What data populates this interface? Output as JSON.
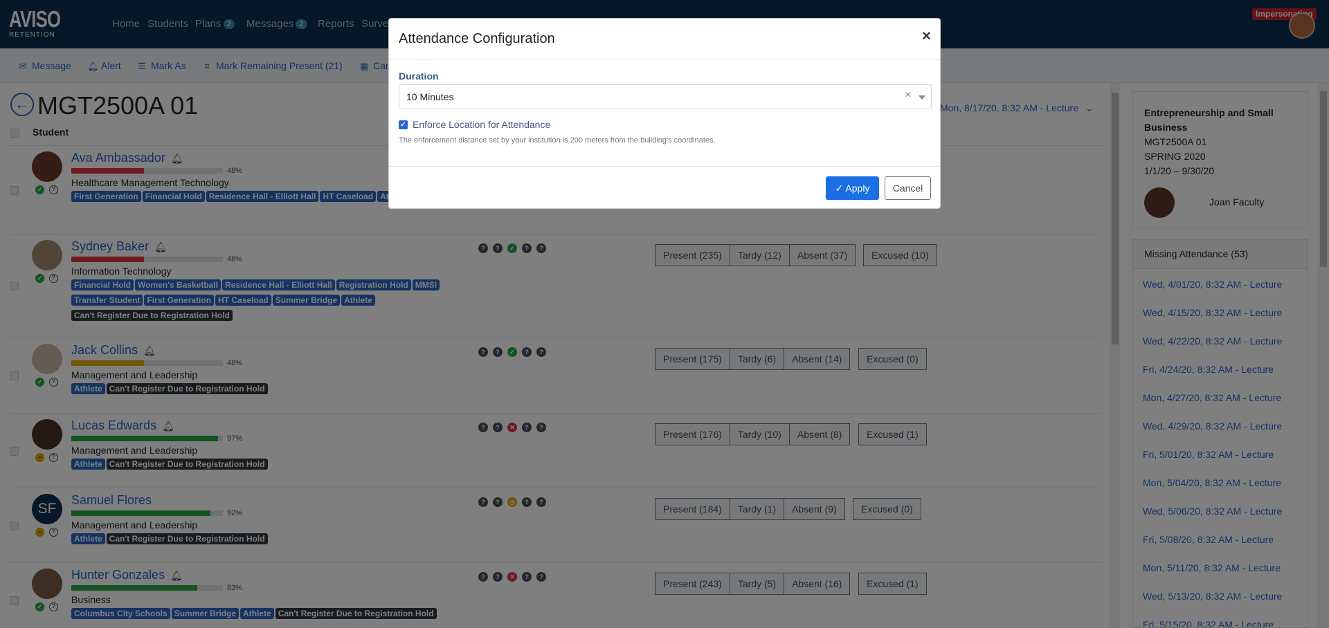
{
  "nav": {
    "logo_top": "AVISO",
    "logo_bottom": "RETENTION",
    "items": [
      {
        "label": "Home"
      },
      {
        "label": "Students"
      },
      {
        "label": "Plans",
        "badge": "2"
      },
      {
        "label": "Messages",
        "badge": "2"
      },
      {
        "label": "Reports"
      },
      {
        "label": "Surveys"
      }
    ],
    "impersonating": "Impersonating"
  },
  "toolbar": {
    "message": "Message",
    "alert": "Alert",
    "mark_as": "Mark As",
    "mark_remaining": "Mark Remaining Present (21)",
    "cancel_cut": "Can"
  },
  "course": {
    "code": "MGT2500A 01",
    "session": "Mon, 8/17/20, 8:32 AM - Lecture",
    "student_header": "Student"
  },
  "students": [
    {
      "name": "Ava Ambassador",
      "pct": "48%",
      "pct_value": 0.48,
      "bar_color": "#dc3545",
      "major": "Healthcare Management Technology",
      "tags": [
        {
          "t": "First Generation"
        },
        {
          "t": "Financial Hold"
        },
        {
          "t": "Residence Hall - Elliott Hall"
        },
        {
          "t": "HT Caseload"
        },
        {
          "t": "Athlete"
        }
      ],
      "present": "",
      "tardy": "",
      "absent": "",
      "excused": ""
    },
    {
      "name": "Sydney Baker",
      "pct": "48%",
      "pct_value": 0.48,
      "bar_color": "#dc3545",
      "major": "Information Technology",
      "tags": [
        {
          "t": "Financial Hold"
        },
        {
          "t": "Women's Basketball"
        },
        {
          "t": "Residence Hall - Elliott Hall"
        },
        {
          "t": "Registration Hold"
        },
        {
          "t": "MMSI"
        },
        {
          "t": "Transfer Student"
        },
        {
          "t": "First Generation"
        },
        {
          "t": "HT Caseload"
        },
        {
          "t": "Summer Bridge"
        },
        {
          "t": "Athlete"
        },
        {
          "t": "Can't Register Due to Registration Hold",
          "dark": true
        }
      ],
      "present": "Present (235)",
      "tardy": "Tardy (12)",
      "absent": "Absent (37)",
      "excused": "Excused (10)"
    },
    {
      "name": "Jack Collins",
      "pct": "48%",
      "pct_value": 0.48,
      "bar_color": "#e0a800",
      "major": "Management and Leadership",
      "tags": [
        {
          "t": "Athlete"
        },
        {
          "t": "Can't Register Due to Registration Hold",
          "dark": true
        }
      ],
      "present": "Present (175)",
      "tardy": "Tardy (6)",
      "absent": "Absent (14)",
      "excused": "Excused (0)"
    },
    {
      "name": "Lucas Edwards",
      "pct": "97%",
      "pct_value": 0.97,
      "bar_color": "#28a745",
      "major": "Management and Leadership",
      "tags": [
        {
          "t": "Athlete"
        },
        {
          "t": "Can't Register Due to Registration Hold",
          "dark": true
        }
      ],
      "present": "Present (176)",
      "tardy": "Tardy (10)",
      "absent": "Absent (8)",
      "excused": "Excused (1)"
    },
    {
      "name": "Samuel Flores",
      "initials": "SF",
      "pct": "92%",
      "pct_value": 0.92,
      "bar_color": "#28a745",
      "major": "Management and Leadership",
      "tags": [
        {
          "t": "Athlete"
        },
        {
          "t": "Can't Register Due to Registration Hold",
          "dark": true
        }
      ],
      "present": "Present (184)",
      "tardy": "Tardy (1)",
      "absent": "Absent (9)",
      "excused": "Excused (0)"
    },
    {
      "name": "Hunter Gonzales",
      "pct": "83%",
      "pct_value": 0.83,
      "bar_color": "#28a745",
      "major": "Business",
      "tags": [
        {
          "t": "Columbus City Schools"
        },
        {
          "t": "Summer Bridge"
        },
        {
          "t": "Athlete"
        },
        {
          "t": "Can't Register Due to Registration Hold",
          "dark": true
        }
      ],
      "present": "Present (243)",
      "tardy": "Tardy (5)",
      "absent": "Absent (16)",
      "excused": "Excused (1)"
    }
  ],
  "sidebar": {
    "course_name": "Entrepreneurship and Small Business",
    "course_code": "MGT2500A 01",
    "term": "SPRING 2020",
    "dates": "1/1/20 – 9/30/20",
    "faculty": "Joan Faculty",
    "missing_header": "Missing Attendance (53)",
    "missing": [
      "Wed, 4/01/20, 8:32 AM - Lecture",
      "Wed, 4/15/20, 8:32 AM - Lecture",
      "Wed, 4/22/20, 8:32 AM - Lecture",
      "Fri, 4/24/20, 8:32 AM - Lecture",
      "Mon, 4/27/20, 8:32 AM - Lecture",
      "Wed, 4/29/20, 8:32 AM - Lecture",
      "Fri, 5/01/20, 8:32 AM - Lecture",
      "Mon, 5/04/20, 8:32 AM - Lecture",
      "Wed, 5/06/20, 8:32 AM - Lecture",
      "Fri, 5/08/20, 8:32 AM - Lecture",
      "Mon, 5/11/20, 8:32 AM - Lecture",
      "Wed, 5/13/20, 8:32 AM - Lecture",
      "Fri, 5/15/20, 8:32 AM - Lecture"
    ]
  },
  "modal": {
    "title": "Attendance Configuration",
    "close": "×",
    "duration_label": "Duration",
    "duration_value": "10 Minutes",
    "enforce_label": "Enforce Location for Attendance",
    "help": "The enforcement distance set by your institution is 200 meters from the building's coordinates.",
    "apply": "Apply",
    "cancel": "Cancel"
  },
  "icons": {
    "check": "check-icon",
    "bell": "bell-icon",
    "question": "question-icon"
  }
}
